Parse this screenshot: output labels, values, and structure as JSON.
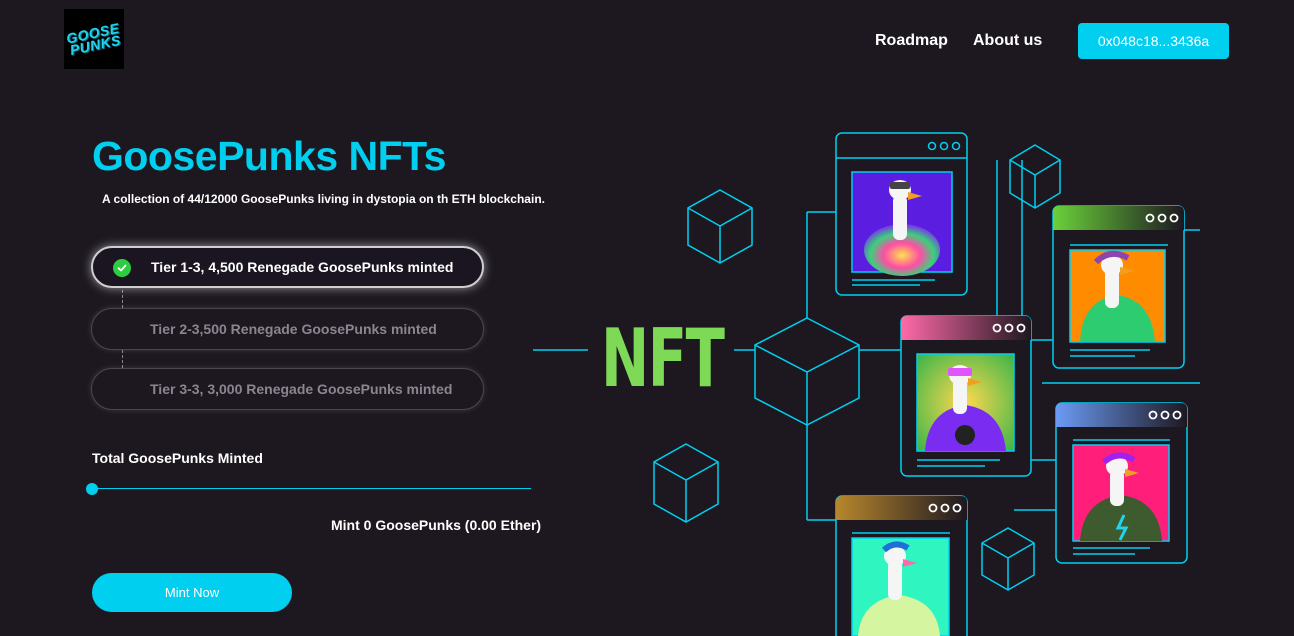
{
  "header": {
    "logo_text": "GOOSE PUNKS",
    "nav": [
      {
        "label": "Roadmap"
      },
      {
        "label": "About us"
      }
    ],
    "wallet_label": "0x048c18...3436a"
  },
  "hero": {
    "title": "GoosePunks NFTs",
    "subtitle": "A collection of 44/12000 GoosePunks living in dystopia on th ETH blockchain."
  },
  "tiers": [
    {
      "label": "Tier 1-3, 4,500 Renegade GoosePunks minted",
      "completed": true
    },
    {
      "label": "Tier 2-3,500 Renegade GoosePunks minted",
      "completed": false
    },
    {
      "label": "Tier 3-3, 3,000 Renegade GoosePunks minted",
      "completed": false
    }
  ],
  "mint": {
    "total_label": "Total GoosePunks Minted",
    "slider_value": 0,
    "count_label": "Mint 0 GoosePunks (0.00 Ether)",
    "button_label": "Mint Now"
  },
  "illustration": {
    "nft_label": "NFT",
    "colors": {
      "accent": "#00cfef",
      "nft_text": "#7ed957",
      "background": "#1d1820"
    }
  }
}
